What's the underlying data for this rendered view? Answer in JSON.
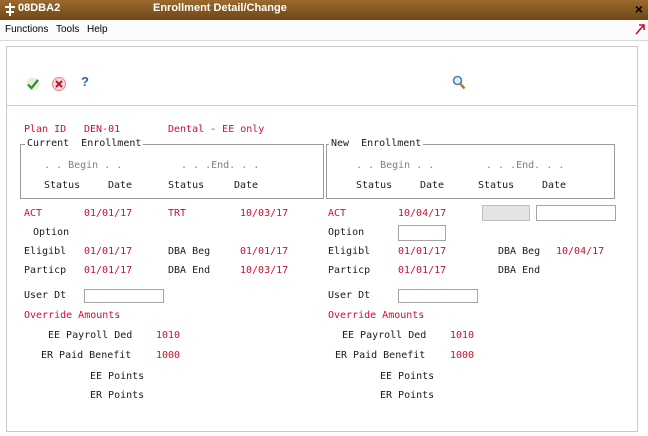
{
  "window": {
    "app_code": "08DBA2",
    "title": "Enrollment Detail/Change",
    "close": "×"
  },
  "menubar": [
    "Functions",
    "Tools",
    "Help"
  ],
  "toolbar": {
    "ok_icon": "checkmark-icon",
    "cancel_icon": "cancel-icon",
    "help_icon": "help-icon",
    "help_label": "?",
    "search_icon": "search-icon"
  },
  "colors": {
    "titlebar": "#7d5020",
    "label_red": "#c8102e"
  },
  "plan": {
    "label": "Plan ID",
    "id": "DEN-01",
    "description": "Dental - EE only"
  },
  "current": {
    "title": "Current  Enrollment",
    "begin_header": ". . Begin . .",
    "end_header": ". . .End. . .",
    "col_status": "Status",
    "col_date": "Date",
    "begin_status": "ACT",
    "begin_date": "01/01/17",
    "end_status": "TRT",
    "end_date": "10/03/17",
    "option_label": "Option",
    "eligibl_label": "Eligibl",
    "eligibl_date": "01/01/17",
    "particp_label": "Particp",
    "particp_date": "01/01/17",
    "dba_beg_label": "DBA Beg",
    "dba_beg_date": "01/01/17",
    "dba_end_label": "DBA End",
    "dba_end_date": "10/03/17",
    "user_dt_label": "User Dt",
    "user_dt_value": "",
    "override_label": "Override Amounts",
    "ee_payroll_label": "EE Payroll Ded",
    "ee_payroll_value": "1010",
    "er_paid_label": "ER Paid Benefit",
    "er_paid_value": "1000",
    "ee_points_label": "EE Points",
    "er_points_label": "ER Points"
  },
  "new": {
    "title": "New  Enrollment",
    "begin_header": ". . Begin . .",
    "end_header": ". . .End. . .",
    "col_status": "Status",
    "col_date": "Date",
    "begin_status": "ACT",
    "begin_date": "10/04/17",
    "end_status": "",
    "end_date": "",
    "option_label": "Option",
    "option_value": "",
    "eligibl_label": "Eligibl",
    "eligibl_date": "01/01/17",
    "particp_label": "Particp",
    "particp_date": "01/01/17",
    "dba_beg_label": "DBA Beg",
    "dba_beg_date": "10/04/17",
    "dba_end_label": "DBA End",
    "dba_end_date": "",
    "user_dt_label": "User Dt",
    "user_dt_value": "",
    "override_label": "Override Amounts",
    "ee_payroll_label": "EE Payroll Ded",
    "ee_payroll_value": "1010",
    "er_paid_label": "ER Paid Benefit",
    "er_paid_value": "1000",
    "ee_points_label": "EE Points",
    "er_points_label": "ER Points"
  }
}
